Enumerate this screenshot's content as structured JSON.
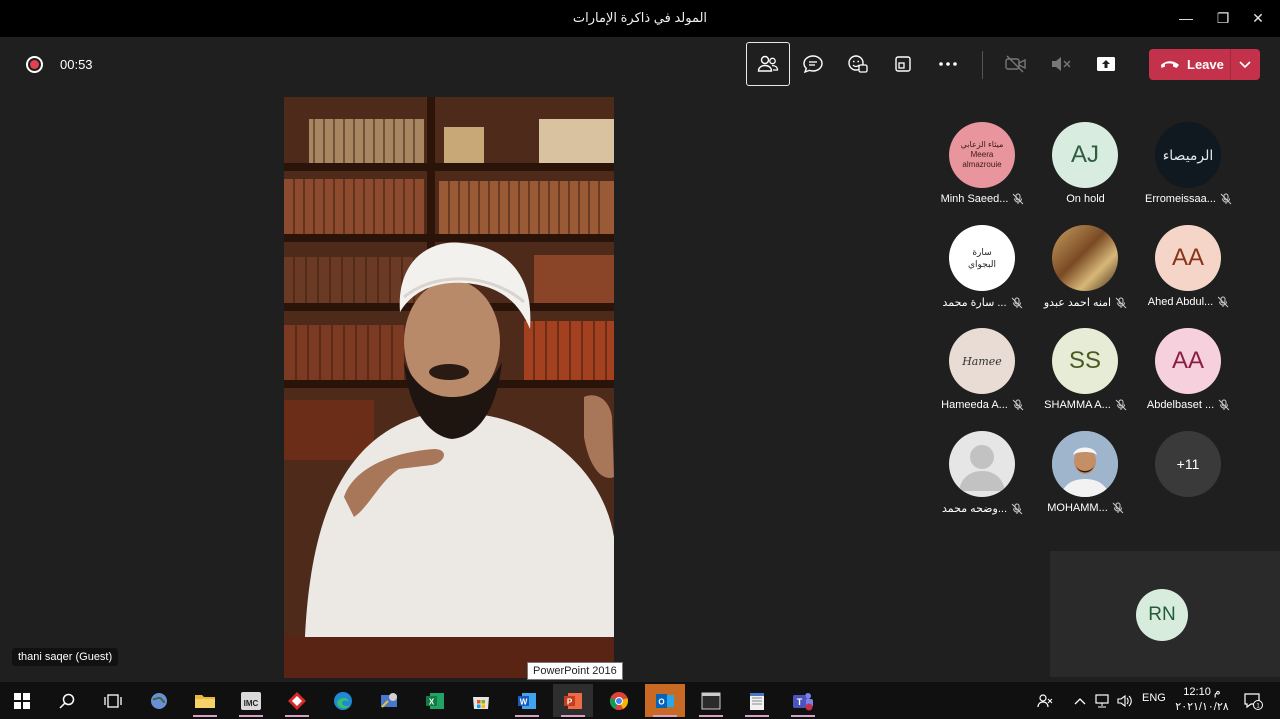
{
  "window": {
    "title": "المولد في ذاكرة الإمارات",
    "minimize_glyph": "—",
    "maximize_glyph": "❐",
    "close_glyph": "✕"
  },
  "toolbar": {
    "recording_time": "00:53",
    "leave_label": "Leave",
    "buttons": [
      "people-icon",
      "chat-icon",
      "reactions-icon",
      "share-tray-icon",
      "more-icon",
      "camera-off-icon",
      "mic-muted-icon",
      "share-screen-icon"
    ]
  },
  "stage": {
    "speaker_name": "thani saqer (Guest)",
    "tooltip": "PowerPoint 2016"
  },
  "participants": [
    {
      "name": "Minh Saeed...",
      "avatar_text": "ميثاء الزعابي",
      "avatar_sub": "Meera\nalmazrouie",
      "avatar_bg": "#e8959d",
      "muted": true
    },
    {
      "name": "On hold",
      "avatar_text": "AJ",
      "avatar_bg": "#d9ece0",
      "avatar_fg": "#2e5e40",
      "muted": false
    },
    {
      "name": "Erromeissaa...",
      "avatar_text": "الرميصاء",
      "avatar_bg": "#101820",
      "muted": true
    },
    {
      "name": "سارة محمد ...",
      "avatar_text": "سارة\nالبجواي",
      "avatar_bg": "#ffffff",
      "muted": true
    },
    {
      "name": "امنه احمد عبدو",
      "avatar_text": "",
      "avatar_bg": "#8a5a2a",
      "muted": true
    },
    {
      "name": "Ahed Abdul...",
      "avatar_text": "AA",
      "avatar_bg": "#f6d5c9",
      "avatar_fg": "#8a3318",
      "muted": true
    },
    {
      "name": "Hameeda A...",
      "avatar_text": "Hamee",
      "avatar_bg": "#e8dcd4",
      "muted": true
    },
    {
      "name": "SHAMMA A...",
      "avatar_text": "SS",
      "avatar_bg": "#e6ecd6",
      "avatar_fg": "#4d5a1f",
      "muted": true
    },
    {
      "name": "Abdelbaset ...",
      "avatar_text": "AA",
      "avatar_bg": "#f7d0dd",
      "avatar_fg": "#8a1f45",
      "muted": true
    },
    {
      "name": "وضحه محمد...",
      "avatar_text": "",
      "avatar_bg": "#e6e6e6",
      "muted": true
    },
    {
      "name": "MOHAMM...",
      "avatar_text": "",
      "avatar_bg": "#8fa7c0",
      "muted": true
    },
    {
      "name": "",
      "avatar_text": "+11",
      "avatar_bg": "#3a3a3a",
      "avatar_fg": "#ffffff",
      "muted": false
    }
  ],
  "self_tile": {
    "avatar_text": "RN"
  },
  "taskbar": {
    "lang": "ENG",
    "time": "م 12:10",
    "date": "٢٠٢١/١٠/٢٨",
    "notification_count": "1"
  }
}
